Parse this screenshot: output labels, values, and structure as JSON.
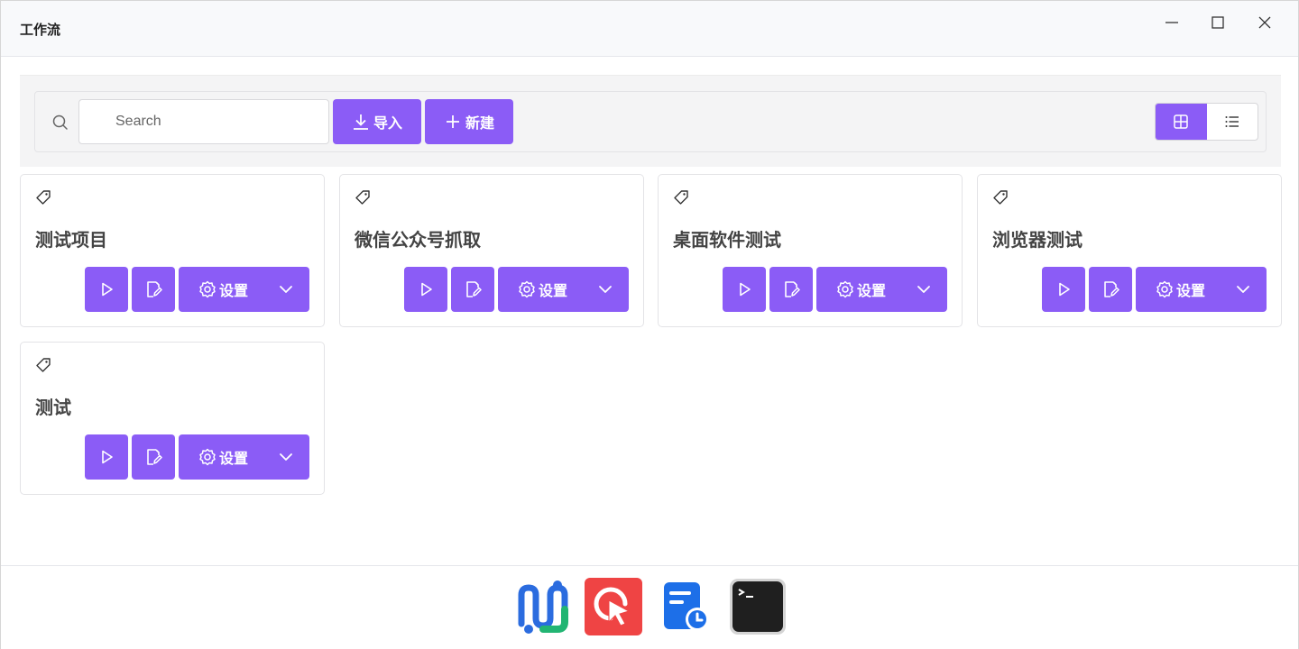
{
  "window": {
    "title": "工作流"
  },
  "toolbar": {
    "search_placeholder": "Search",
    "import_label": "导入",
    "new_label": "新建"
  },
  "cards": [
    {
      "title": "测试项目",
      "settings_label": "设置"
    },
    {
      "title": "微信公众号抓取",
      "settings_label": "设置"
    },
    {
      "title": "桌面软件测试",
      "settings_label": "设置"
    },
    {
      "title": "浏览器测试",
      "settings_label": "设置"
    },
    {
      "title": "测试",
      "settings_label": "设置"
    }
  ],
  "dock": {
    "apps": [
      "workflow-app-icon",
      "click-automation-app-icon",
      "scheduled-task-app-icon",
      "terminal-app-icon"
    ]
  },
  "colors": {
    "accent": "#8b5cf6",
    "titlebar_bg": "#f8f9fb",
    "toolbar_bg": "#f4f4f5"
  }
}
